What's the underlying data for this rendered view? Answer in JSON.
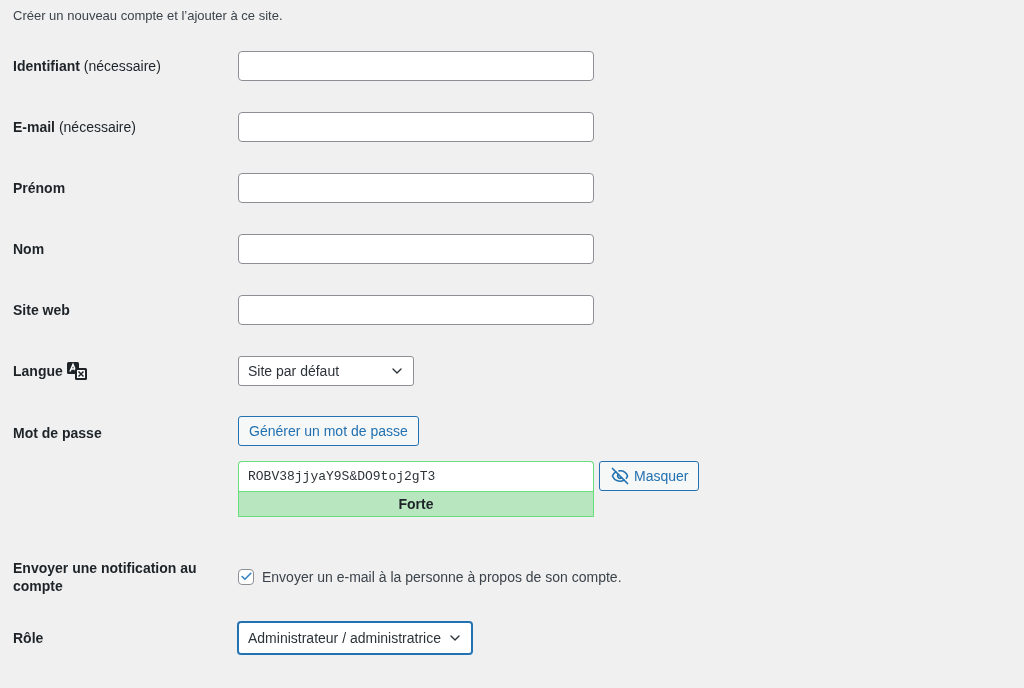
{
  "intro": "Créer un nouveau compte et l’ajouter à ce site.",
  "fields": [
    {
      "kind": "text",
      "label": "Identifiant",
      "note": "(nécessaire)"
    },
    {
      "kind": "text",
      "label": "E-mail",
      "note": "(nécessaire)"
    },
    {
      "kind": "text",
      "label": "Prénom"
    },
    {
      "kind": "text",
      "label": "Nom"
    },
    {
      "kind": "text",
      "label": "Site web"
    },
    {
      "kind": "language",
      "label": "Langue",
      "value": "Site par défaut",
      "focused": false
    },
    {
      "kind": "password",
      "label": "Mot de passe",
      "generate_button": "Générer un mot de passe",
      "value": "ROBV38jjyaY9S&DO9toj2gT3",
      "visible": true,
      "strength": {
        "label": "Forte",
        "kind": "strong"
      },
      "toggle_button": "Masquer"
    },
    {
      "kind": "checkbox",
      "label": "Envoyer une notification au compte",
      "checked": true,
      "text": "Envoyer un e-mail à la personne à propos de son compte."
    },
    {
      "kind": "select",
      "label": "Rôle",
      "value": "Administrateur / administratrice",
      "focused": true
    }
  ]
}
